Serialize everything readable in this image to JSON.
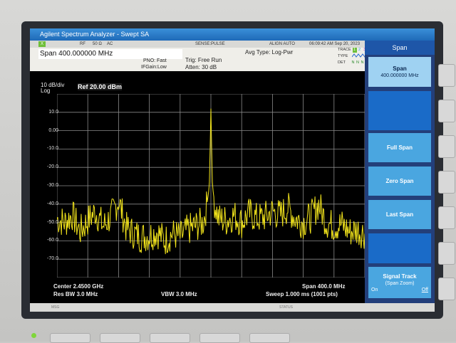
{
  "window": {
    "title": "Agilent Spectrum Analyzer - Swept SA"
  },
  "status_bar": {
    "rf": "RF",
    "impedance": "50 Ω",
    "coupling": "AC",
    "sense": "SENSE:PULSE",
    "align": "ALIGN AUTO",
    "datetime": "06:09:42 AM Sep 20, 2023"
  },
  "header": {
    "span": "Span 400.000000 MHz",
    "pno": "PNO: Fast",
    "ifgain": "IFGain:Low",
    "trig": "Trig: Free Run",
    "atten": "Atten: 30 dB",
    "avg_type": "Avg Type: Log-Pwr",
    "trace_label": "TRACE",
    "type_label": "TYPE",
    "det_label": "DET",
    "trace_nums": [
      "1",
      "2",
      "3",
      "4",
      "5",
      "6"
    ],
    "det_values": "N N N N N N"
  },
  "plot": {
    "scale_div": "10 dB/div",
    "scale_type": "Log",
    "ref_level": "Ref 20.00 dBm",
    "y_labels": [
      "10.0",
      "0.00",
      "-10.0",
      "-20.0",
      "-30.0",
      "-40.0",
      "-50.0",
      "-60.0",
      "-70.0"
    ],
    "center": "Center 2.4500 GHz",
    "res_bw": "Res BW 3.0 MHz",
    "vbw": "VBW 3.0 MHz",
    "span": "Span 400.0 MHz",
    "sweep": "Sweep  1.000 ms (1001 pts)",
    "msg_left": "MSG",
    "msg_status": "STATUS"
  },
  "softkeys": {
    "title": "Span",
    "span_label": "Span",
    "span_value": "400.000000 MHz",
    "full_span": "Full Span",
    "zero_span": "Zero Span",
    "last_span": "Last Span",
    "signal_track": "Signal Track",
    "signal_track_sub": "(Span Zoom)",
    "on": "On",
    "off": "Off"
  },
  "chart_data": {
    "type": "line",
    "xlabel": "",
    "ylabel": "",
    "x_center_ghz": 2.45,
    "x_span_mhz": 400,
    "xlim_ghz": [
      2.25,
      2.65
    ],
    "ylim": [
      -80,
      20
    ],
    "y_ticks": [
      10,
      0,
      -10,
      -20,
      -30,
      -40,
      -50,
      -60,
      -70
    ],
    "grid": true,
    "trace_color": "#f2e41c",
    "series": [
      {
        "x_mhz": [
          2250,
          2260,
          2270,
          2280,
          2290,
          2300,
          2310,
          2320,
          2330,
          2340,
          2350,
          2360,
          2370,
          2380,
          2390,
          2400,
          2410,
          2420,
          2430,
          2440,
          2445,
          2448,
          2450,
          2452,
          2455,
          2460,
          2470,
          2480,
          2490,
          2500,
          2510,
          2520,
          2530,
          2540,
          2550,
          2560,
          2570,
          2580,
          2590,
          2600,
          2610,
          2620,
          2630,
          2640,
          2650
        ],
        "y": [
          -48,
          -50,
          -46,
          -55,
          -49,
          -44,
          -52,
          -47,
          -38,
          -53,
          -56,
          -58,
          -57,
          -55,
          -60,
          -56,
          -58,
          -54,
          -52,
          -50,
          -40,
          -30,
          12,
          -30,
          -40,
          -48,
          -49,
          -46,
          -50,
          -45,
          -48,
          -47,
          -44,
          -46,
          -42,
          -48,
          -50,
          -47,
          -40,
          -50,
          -52,
          -51,
          -55,
          -54,
          -56
        ]
      }
    ]
  },
  "colors": {
    "title_bar": "#1f6ab8",
    "softkey": "#4aa6e0",
    "trace": "#f2e41c",
    "grid": "#8a8a8a",
    "active_trace_box": "#6fbf3a"
  }
}
